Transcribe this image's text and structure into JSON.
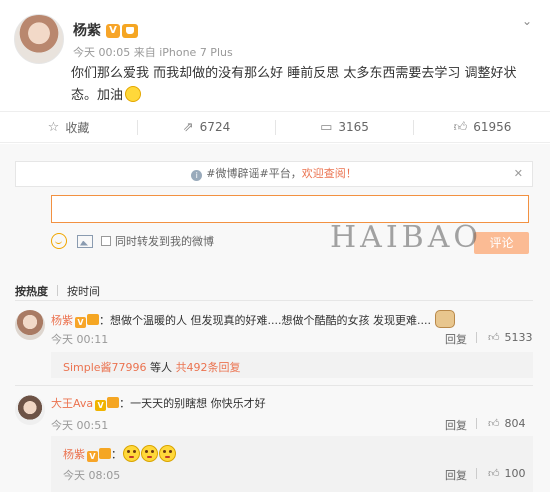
{
  "post": {
    "author": "杨紫",
    "verified_badge": "V",
    "meta": "今天 00:05 来自 iPhone 7 Plus",
    "text": "你们那么爱我 而我却做的没有那么好 睡前反思 太多东西需要去学习 调整好状态。加油"
  },
  "actions": {
    "favorite_label": "收藏",
    "repost_count": "6724",
    "comment_count": "3165",
    "like_count": "61956"
  },
  "notice": {
    "prefix": "#微博辟谣#平台，",
    "highlight": "欢迎查阅！"
  },
  "composer": {
    "value": "",
    "repost_label": "同时转发到我的微博",
    "submit_label": "评论"
  },
  "sort": {
    "hot_label": "按热度",
    "time_label": "按时间"
  },
  "comments": [
    {
      "author": "杨紫",
      "text": "：想做个温暖的人 但发现真的好难....想做个酷酷的女孩 发现更难....",
      "time": "今天 00:11",
      "reply_label": "回复",
      "likes": "5133"
    },
    {
      "author": "大王Ava",
      "text": "：一天天的别瞎想 你快乐才好",
      "time": "今天 00:51",
      "reply_label": "回复",
      "likes": "804"
    }
  ],
  "more_replies": {
    "user": "Simple酱77996",
    "mid": " 等人 ",
    "count": "共492条回复"
  },
  "subreply": {
    "author": "杨紫",
    "text": "：",
    "time": "今天 08:05",
    "reply_label": "回复",
    "likes": "100"
  },
  "watermark": "HAIBAO",
  "colors": {
    "accent": "#eb7350",
    "submit_disabled": "#fbbb94",
    "badge": "#f7a529"
  }
}
